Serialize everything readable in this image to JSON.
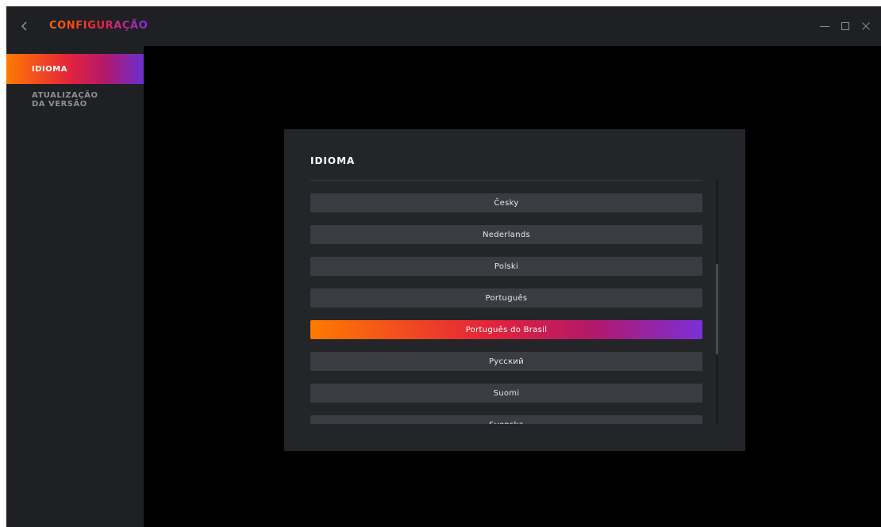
{
  "window": {
    "title": "CONFIGURAÇÃO"
  },
  "sidebar": {
    "items": [
      {
        "label": "IDIOMA",
        "active": true
      },
      {
        "label": "ATUALIZAÇÃO DA VERSÃO",
        "active": false
      }
    ]
  },
  "panel": {
    "title": "IDIOMA",
    "languages": [
      "Česky",
      "Nederlands",
      "Polski",
      "Português",
      "Português do Brasil",
      "Русский",
      "Suomi",
      "Svenska"
    ],
    "selected_language": "Português do Brasil",
    "scroll": {
      "visible_fraction": 0.37,
      "scroll_fraction": 0.55
    }
  },
  "icons": {
    "back": "chevron-left-icon",
    "minimize": "minimize-icon",
    "maximize": "maximize-icon",
    "close": "close-icon"
  },
  "colors": {
    "accent_start": "#ff7a00",
    "accent_mid": "#e4243a",
    "accent_end": "#7b2fd8",
    "panel_bg": "#242528",
    "button_bg": "#3b3c42"
  }
}
